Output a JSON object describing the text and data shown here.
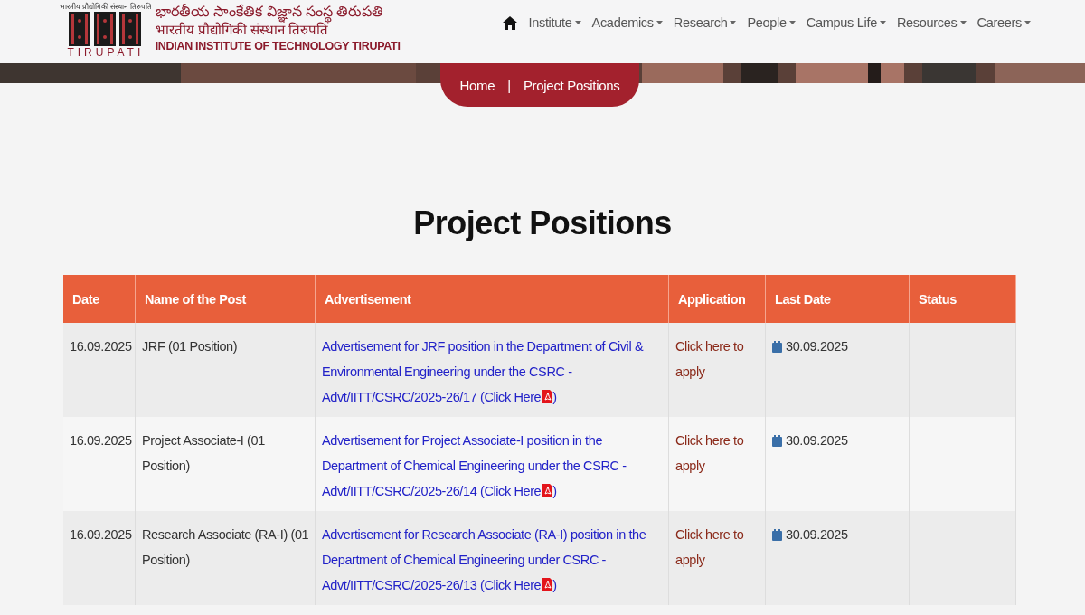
{
  "header": {
    "logo_caption": "भारतीय प्रौद्योगिकी संस्थान तिरुपति",
    "logo_word": "TIRUPATI",
    "name_telugu": "భారతీయ సాంకేతిక విజ్ఞాన సంస్థ తిరుపతి",
    "name_hindi": "भारतीय प्रौद्योगिकी संस्थान तिरुपति",
    "name_english": "INDIAN INSTITUTE OF TECHNOLOGY TIRUPATI"
  },
  "nav": [
    {
      "label": "Institute"
    },
    {
      "label": "Academics"
    },
    {
      "label": "Research"
    },
    {
      "label": "People"
    },
    {
      "label": "Campus Life"
    },
    {
      "label": "Resources"
    },
    {
      "label": "Careers"
    }
  ],
  "breadcrumb": {
    "home": "Home",
    "separator": "|",
    "current": "Project Positions"
  },
  "title": "Project Positions",
  "table": {
    "columns": [
      "Date",
      "Name of the Post",
      "Advertisement",
      "Application",
      "Last Date",
      "Status"
    ],
    "rows": [
      {
        "date": "16.09.2025",
        "post": "JRF (01 Position)",
        "advertisement": "Advertisement for JRF position in the Department of Civil & Environmental Engineering under the CSRC - Advt/IITT/CSRC/2025-26/17 (Click Here",
        "closing": ")",
        "application": "Click here to apply",
        "last_date": "30.09.2025"
      },
      {
        "date": "16.09.2025",
        "post": "Project Associate-I (01 Position)",
        "advertisement": "Advertisement for Project Associate-I position in the Department of Chemical Engineering under the CSRC - Advt/IITT/CSRC/2025-26/14 (Click Here",
        "closing": ")",
        "application": "Click here to apply",
        "last_date": "30.09.2025"
      },
      {
        "date": "16.09.2025",
        "post": "Research Associate (RA-I) (01 Position)",
        "advertisement": "Advertisement for Research Associate (RA-I) position in the Department of Chemical Engineering under CSRC - Advt/IITT/CSRC/2025-26/13 (Click Here",
        "closing": ")",
        "application": "Click here to apply",
        "last_date": "30.09.2025"
      }
    ]
  }
}
